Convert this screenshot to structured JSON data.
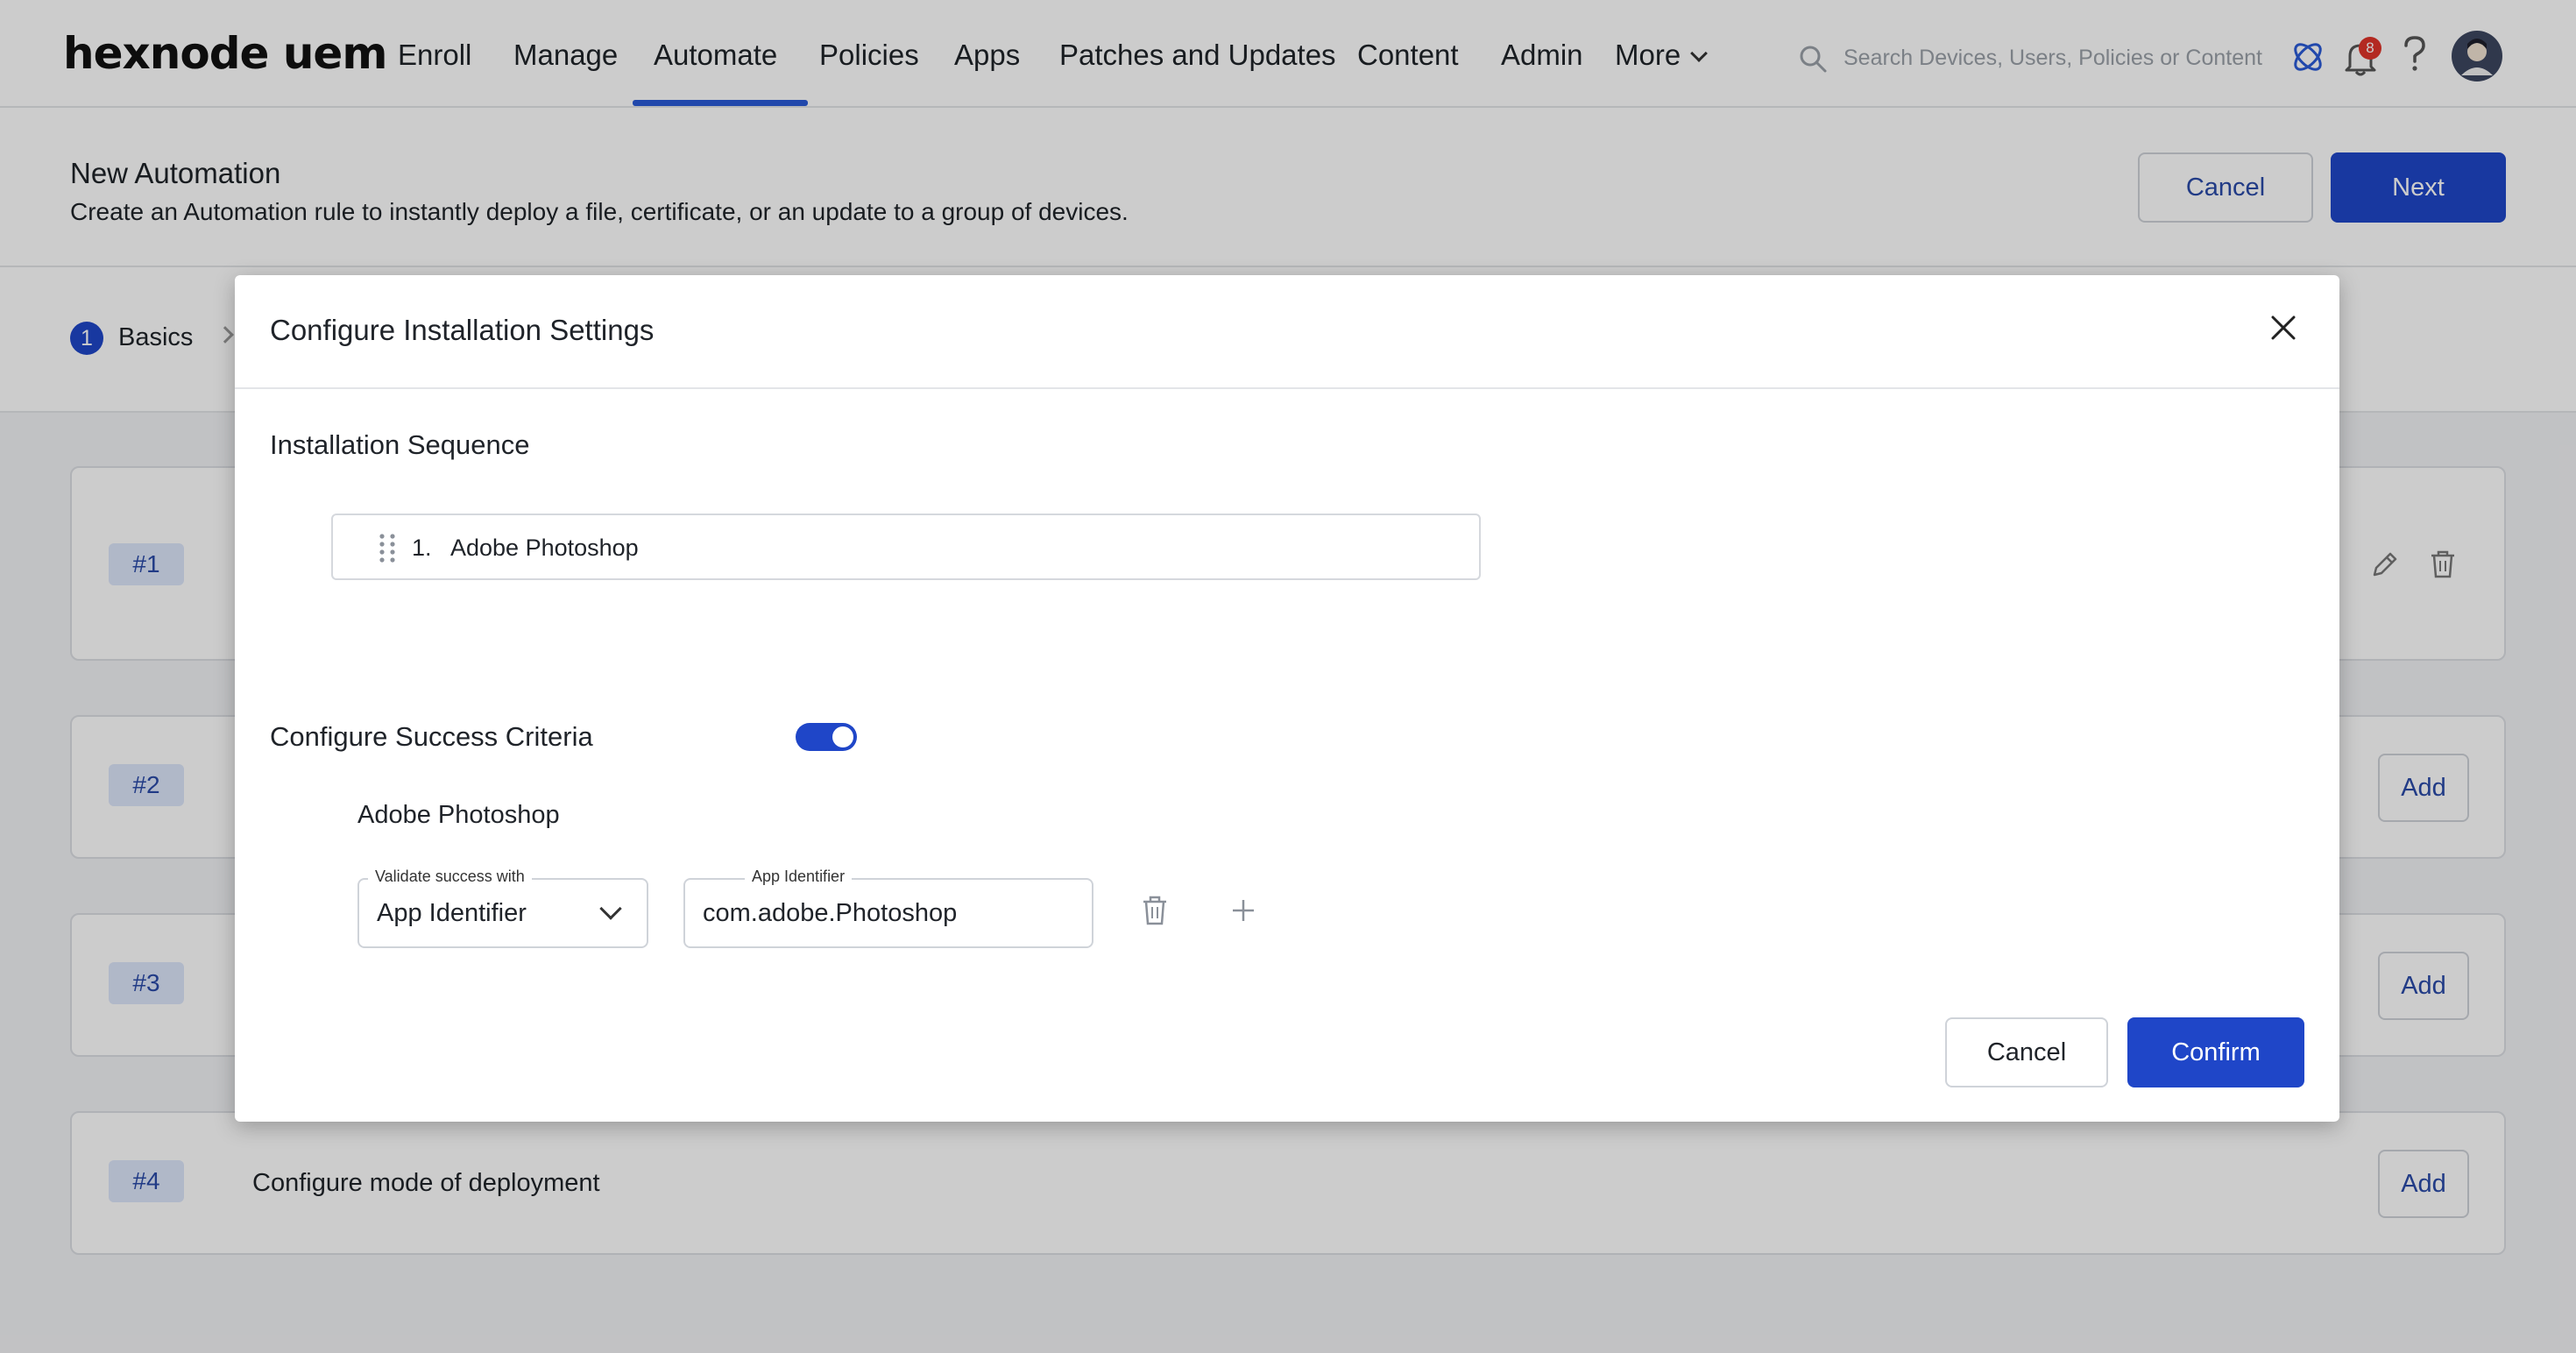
{
  "app": {
    "logo": "hexnode uem"
  },
  "nav": {
    "items": [
      "Enroll",
      "Manage",
      "Automate",
      "Policies",
      "Apps",
      "Patches and Updates",
      "Content",
      "Admin"
    ],
    "more_label": "More",
    "active": "Automate",
    "notification_count": "8"
  },
  "search": {
    "placeholder": "Search Devices, Users, Policies or Content"
  },
  "page": {
    "title": "New Automation",
    "subtitle": "Create an Automation rule to instantly deploy a file, certificate, or an update to a group of devices.",
    "cancel_label": "Cancel",
    "next_label": "Next"
  },
  "steps": [
    {
      "num": "1",
      "label": "Basics"
    }
  ],
  "cards": [
    {
      "tag": "#1",
      "text": ""
    },
    {
      "tag": "#2",
      "text": "",
      "add_label": "Add"
    },
    {
      "tag": "#3",
      "text": "",
      "add_label": "Add"
    },
    {
      "tag": "#4",
      "text": "Configure mode of deployment",
      "add_label": "Add"
    }
  ],
  "modal": {
    "title": "Configure Installation Settings",
    "sequence_title": "Installation Sequence",
    "sequence": [
      {
        "index": "1.",
        "name": "Adobe Photoshop"
      }
    ],
    "criteria_title": "Configure Success Criteria",
    "criteria_enabled": true,
    "criteria_app": "Adobe Photoshop",
    "validate_label": "Validate success with",
    "validate_value": "App Identifier",
    "identifier_label": "App Identifier",
    "identifier_value": "com.adobe.Photoshop",
    "cancel_label": "Cancel",
    "confirm_label": "Confirm"
  },
  "colors": {
    "primary": "#1f46c8",
    "accent": "#2a5bd7",
    "badge": "#e0342a"
  }
}
